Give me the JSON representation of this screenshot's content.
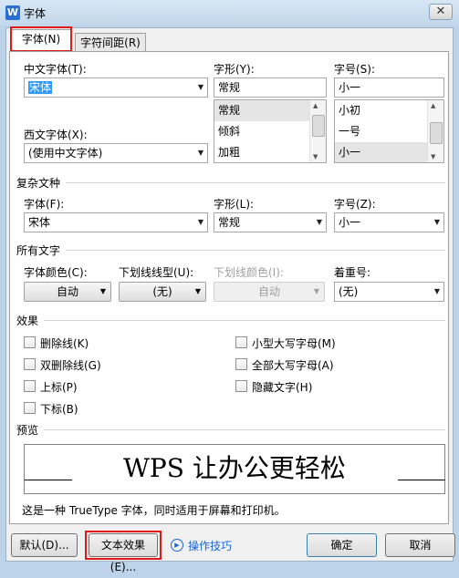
{
  "window": {
    "title": "字体",
    "close_glyph": "✕",
    "app_icon_glyph": "W"
  },
  "tabs": [
    {
      "label": "字体(N)",
      "active": true
    },
    {
      "label": "字符间距(R)",
      "active": false
    }
  ],
  "chinese_font": {
    "label": "中文字体(T):",
    "value": "宋体"
  },
  "western_font": {
    "label": "西文字体(X):",
    "value": "(使用中文字体)"
  },
  "style": {
    "label": "字形(Y):",
    "value": "常规",
    "options": [
      "常规",
      "倾斜",
      "加粗"
    ],
    "selected": "常规"
  },
  "size": {
    "label": "字号(S):",
    "value": "小一",
    "options": [
      "小初",
      "一号",
      "小一"
    ],
    "selected": "小一"
  },
  "complex": {
    "section_label": "复杂文种",
    "font_label": "字体(F):",
    "font_value": "宋体",
    "style_label": "字形(L):",
    "style_value": "常规",
    "size_label": "字号(Z):",
    "size_value": "小一"
  },
  "all_text": {
    "section_label": "所有文字",
    "color_label": "字体颜色(C):",
    "color_value": "自动",
    "underline_label": "下划线线型(U):",
    "underline_value": "(无)",
    "underline_color_label": "下划线颜色(I):",
    "underline_color_value": "自动",
    "emphasis_label": "着重号:",
    "emphasis_value": "(无)"
  },
  "effects": {
    "section_label": "效果",
    "left": [
      "删除线(K)",
      "双删除线(G)",
      "上标(P)",
      "下标(B)"
    ],
    "right": [
      "小型大写字母(M)",
      "全部大写字母(A)",
      "隐藏文字(H)"
    ]
  },
  "preview": {
    "section_label": "预览",
    "sample": "WPS 让办公更轻松",
    "description": "这是一种 TrueType 字体，同时适用于屏幕和打印机。"
  },
  "buttons": {
    "default": "默认(D)...",
    "text_effects": "文本效果(E)...",
    "tips": "操作技巧",
    "ok": "确定",
    "cancel": "取消"
  },
  "colors": {
    "highlight": "#e21919",
    "link": "#1a66d8",
    "selection": "#3399ff"
  }
}
